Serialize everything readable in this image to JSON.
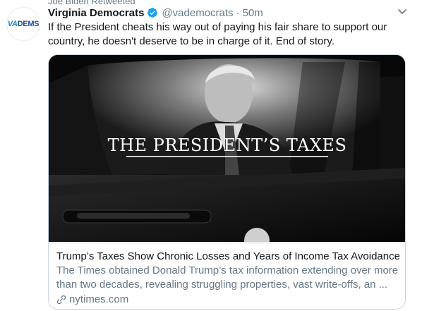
{
  "retweet": {
    "label": "Joe Biden Retweeted"
  },
  "author": {
    "avatar_text_prefix": "VA",
    "avatar_text_suffix": "DEMS",
    "name": "Virginia Democrats",
    "handle": "@vademocrats",
    "separator": "·",
    "time": "50m",
    "verified": true
  },
  "tweet": {
    "text": "If the President cheats his way out of paying his fair share to support our country, he doesn't deserve to be in charge of it. End of story."
  },
  "card": {
    "image_caption": "THE PRESIDENT’S TAXES",
    "title": "Trump’s Taxes Show Chronic Losses and Years of Income Tax Avoidance",
    "description": "The Times obtained Donald Trump’s tax information extending over more than two decades, revealing struggling properties, vast write-offs, an ...",
    "domain": "nytimes.com"
  },
  "icons": {
    "verified": "verified-badge-icon",
    "caret": "chevron-down-icon",
    "link": "link-icon"
  },
  "colors": {
    "text": "#14171a",
    "secondary": "#657786",
    "verified": "#1da1f2",
    "border": "#ccd6dd"
  }
}
